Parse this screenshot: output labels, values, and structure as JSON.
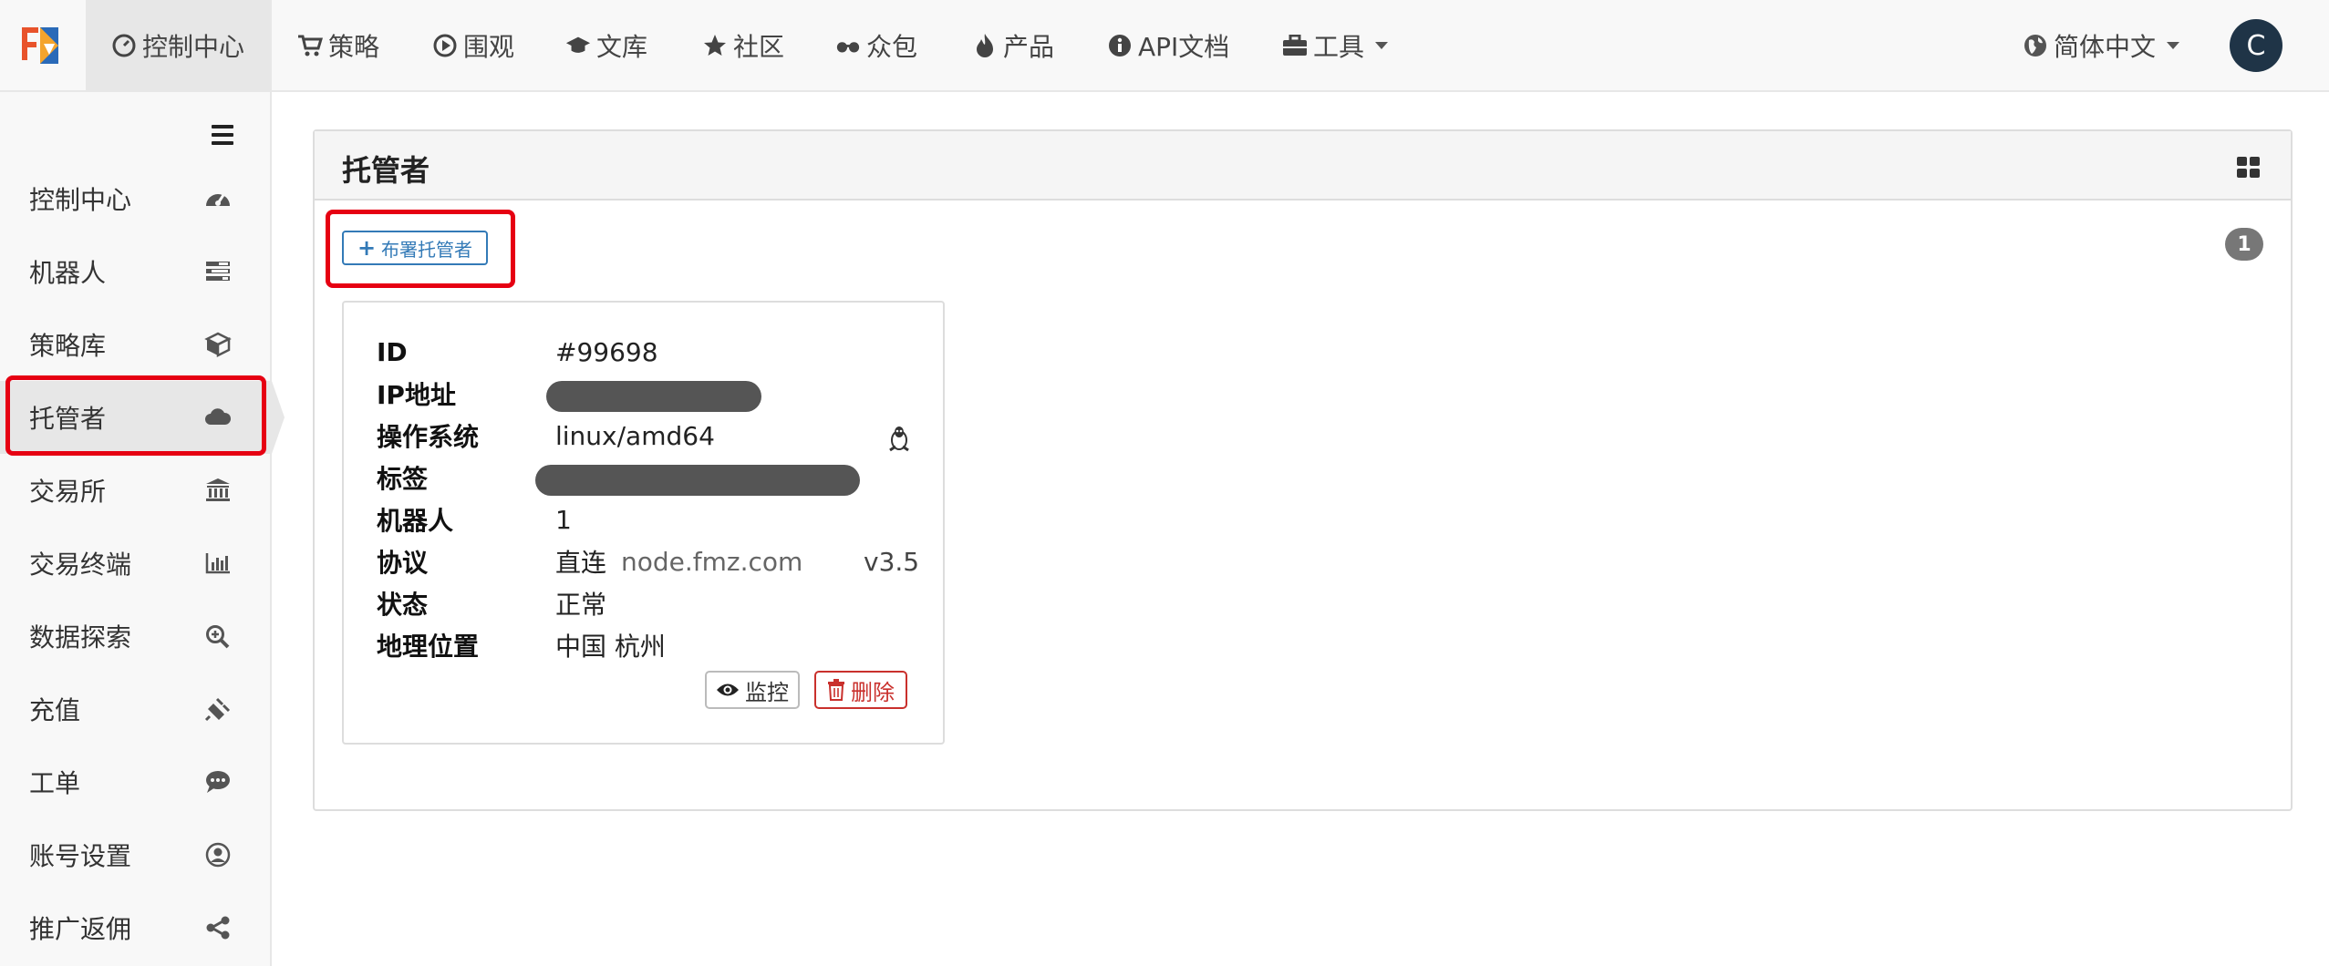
{
  "topnav": {
    "items": [
      {
        "label": "控制中心",
        "icon": "dashboard-icon"
      },
      {
        "label": "策略",
        "icon": "cart-icon"
      },
      {
        "label": "围观",
        "icon": "play-circle-icon"
      },
      {
        "label": "文库",
        "icon": "graduation-cap-icon"
      },
      {
        "label": "社区",
        "icon": "star-icon"
      },
      {
        "label": "众包",
        "icon": "glasses-icon"
      },
      {
        "label": "产品",
        "icon": "fire-icon"
      },
      {
        "label": "API文档",
        "icon": "info-circle-icon"
      },
      {
        "label": "工具",
        "icon": "briefcase-icon"
      }
    ],
    "language": "简体中文",
    "avatar_letter": "C"
  },
  "sidebar": {
    "items": [
      {
        "label": "控制中心",
        "icon": "dashboard-icon"
      },
      {
        "label": "机器人",
        "icon": "tasks-icon"
      },
      {
        "label": "策略库",
        "icon": "cube-icon"
      },
      {
        "label": "托管者",
        "icon": "cloud-icon"
      },
      {
        "label": "交易所",
        "icon": "bank-icon"
      },
      {
        "label": "交易终端",
        "icon": "bar-chart-icon"
      },
      {
        "label": "数据探索",
        "icon": "zoom-in-icon"
      },
      {
        "label": "充值",
        "icon": "plug-icon"
      },
      {
        "label": "工单",
        "icon": "comment-icon"
      },
      {
        "label": "账号设置",
        "icon": "user-circle-icon"
      },
      {
        "label": "推广返佣",
        "icon": "share-icon"
      }
    ],
    "active_index": 3
  },
  "panel": {
    "title": "托管者",
    "deploy_label": "布署托管者",
    "count": "1"
  },
  "card": {
    "fields": {
      "id": {
        "key": "ID",
        "value": "#99698"
      },
      "ip": {
        "key": "IP地址",
        "value": ""
      },
      "os": {
        "key": "操作系统",
        "value": "linux/amd64"
      },
      "tags": {
        "key": "标签",
        "value": ""
      },
      "robots": {
        "key": "机器人",
        "value": "1"
      },
      "protocol": {
        "key": "协议",
        "value": "直连",
        "host": "node.fmz.com",
        "version": "v3.5"
      },
      "status": {
        "key": "状态",
        "value": "正常"
      },
      "location": {
        "key": "地理位置",
        "value": "中国 杭州"
      }
    },
    "monitor_label": "监控",
    "delete_label": "删除"
  },
  "colors": {
    "accent": "#337ab7",
    "danger": "#c9302c",
    "highlight_box": "#e60012",
    "avatar_bg": "#1f3447"
  }
}
